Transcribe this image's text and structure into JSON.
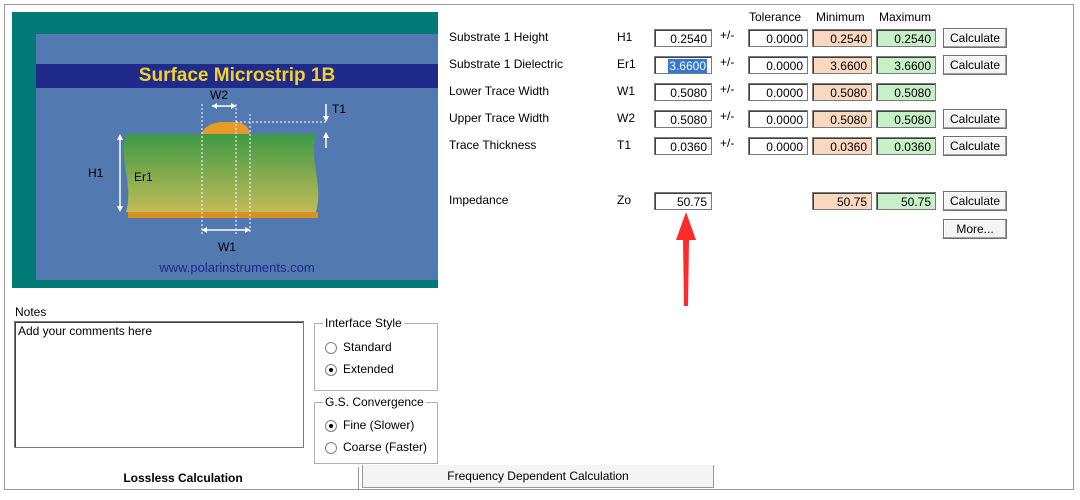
{
  "diagram": {
    "title": "Surface Microstrip 1B",
    "labels": {
      "w2": "W2",
      "t1": "T1",
      "h1": "H1",
      "er1": "Er1",
      "w1": "W1"
    },
    "url": "www.polarinstruments.com"
  },
  "headers": {
    "tolerance": "Tolerance",
    "minimum": "Minimum",
    "maximum": "Maximum"
  },
  "params": [
    {
      "name": "Substrate 1 Height",
      "symbol": "H1",
      "value": "0.2540",
      "pm": "+/-",
      "tolerance": "0.0000",
      "min": "0.2540",
      "max": "0.2540",
      "calc": "Calculate"
    },
    {
      "name": "Substrate 1 Dielectric",
      "symbol": "Er1",
      "value": "3.6600",
      "pm": "+/-",
      "tolerance": "0.0000",
      "min": "3.6600",
      "max": "3.6600",
      "calc": "Calculate"
    },
    {
      "name": "Lower Trace Width",
      "symbol": "W1",
      "value": "0.5080",
      "pm": "+/-",
      "tolerance": "0.0000",
      "min": "0.5080",
      "max": "0.5080",
      "calc": ""
    },
    {
      "name": "Upper Trace Width",
      "symbol": "W2",
      "value": "0.5080",
      "pm": "+/-",
      "tolerance": "0.0000",
      "min": "0.5080",
      "max": "0.5080",
      "calc": "Calculate"
    },
    {
      "name": "Trace Thickness",
      "symbol": "T1",
      "value": "0.0360",
      "pm": "+/-",
      "tolerance": "0.0000",
      "min": "0.0360",
      "max": "0.0360",
      "calc": "Calculate"
    }
  ],
  "impedance": {
    "name": "Impedance",
    "symbol": "Zo",
    "value": "50.75",
    "min": "50.75",
    "max": "50.75",
    "calc": "Calculate",
    "more": "More..."
  },
  "notes": {
    "label": "Notes",
    "text": "Add your comments here"
  },
  "interface_style": {
    "title": "Interface Style",
    "options": [
      "Standard",
      "Extended"
    ],
    "selected": "Extended"
  },
  "convergence": {
    "title": "G.S. Convergence",
    "options": [
      "Fine (Slower)",
      "Coarse (Faster)"
    ],
    "selected": "Fine (Slower)"
  },
  "tabs": [
    "Lossless Calculation",
    "Frequency Dependent Calculation"
  ],
  "colors": {
    "diagram_bg": "#017a77",
    "diagram_panel": "#527ab0",
    "title_bar": "#1f2a8a",
    "title_text": "#f1d12a",
    "min_fill": "#f8d8be",
    "max_fill": "#c8f0c8",
    "arrow": "#ff2a2a"
  }
}
